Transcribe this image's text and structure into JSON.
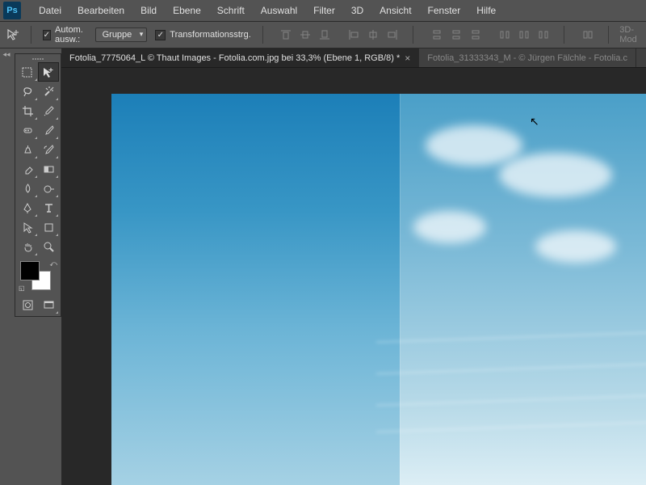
{
  "app": {
    "logo": "Ps"
  },
  "menu": [
    "Datei",
    "Bearbeiten",
    "Bild",
    "Ebene",
    "Schrift",
    "Auswahl",
    "Filter",
    "3D",
    "Ansicht",
    "Fenster",
    "Hilfe"
  ],
  "options": {
    "auto_select_label": "Autom. ausw.:",
    "auto_select_checked": true,
    "group_dropdown": "Gruppe",
    "transform_label": "Transformationsstrg.",
    "transform_checked": true,
    "mode3d": "3D-Mod"
  },
  "tabs": [
    {
      "label": "Fotolia_7775064_L © Thaut Images - Fotolia.com.jpg bei 33,3% (Ebene 1, RGB/8) *",
      "active": true
    },
    {
      "label": "Fotolia_31333343_M - © Jürgen Fälchle - Fotolia.c",
      "active": false
    }
  ],
  "colors": {
    "fg": "#000000",
    "bg": "#ffffff"
  }
}
